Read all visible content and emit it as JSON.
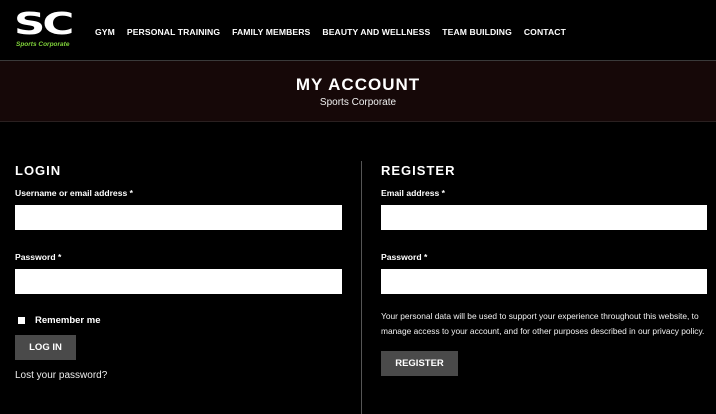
{
  "logo": {
    "mark": "SC",
    "sub": "Sports Corporate"
  },
  "nav": [
    "GYM",
    "PERSONAL TRAINING",
    "FAMILY MEMBERS",
    "BEAUTY AND WELLNESS",
    "TEAM BUILDING",
    "CONTACT"
  ],
  "band": {
    "title": "MY ACCOUNT",
    "subtitle": "Sports Corporate"
  },
  "login": {
    "title": "LOGIN",
    "username_label": "Username or email address",
    "password_label": "Password",
    "required_mark": "*",
    "remember_label": "Remember me",
    "button": "LOG IN",
    "lost_password": "Lost your password?"
  },
  "register": {
    "title": "REGISTER",
    "email_label": "Email address",
    "password_label": "Password",
    "required_mark": "*",
    "privacy_text": "Your personal data will be used to support your experience throughout this website, to manage access to your account, and for other purposes described in our privacy policy.",
    "button": "REGISTER"
  },
  "colors": {
    "accent_green": "#7fd23a",
    "band_bg": "#160808",
    "button_bg": "#4a4a4a"
  }
}
